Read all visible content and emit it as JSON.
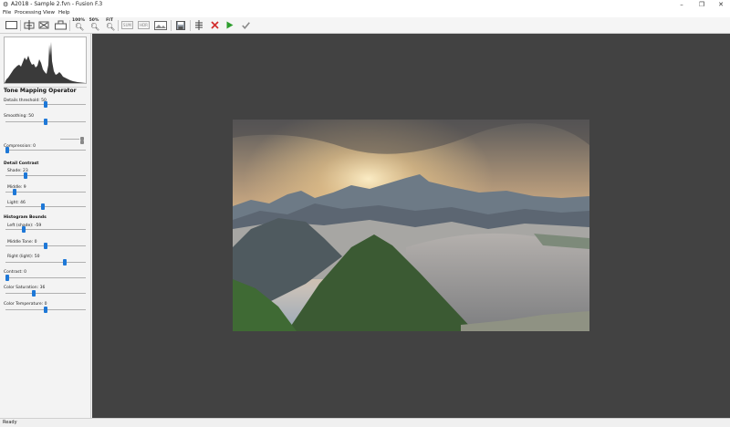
{
  "window": {
    "title": "A2018 - Sample 2.fvn - Fusion F.3",
    "app_icon": "app-logo-icon",
    "controls": [
      "minimize-icon",
      "restore-icon",
      "close-icon"
    ]
  },
  "menu": [
    "File",
    "Processing",
    "View",
    "Help"
  ],
  "toolbar": {
    "zoom_100": "100%",
    "zoom_50": "50%",
    "zoom_fit": "FIT",
    "sum_label": "SUM",
    "hdr_label": "HDR",
    "icons": [
      "frame-icon",
      "align-icon",
      "distribute-icon",
      "crop-icon",
      "zoom-icon",
      "image-icon",
      "save-icon",
      "split-icon",
      "cancel-icon",
      "run-icon",
      "apply-icon"
    ],
    "colors": {
      "cancel": "#d32f2f",
      "run": "#2e9e2e",
      "apply": "#8a8a8a"
    }
  },
  "panel": {
    "title": "Tone Mapping Operator",
    "sliders": {
      "details_threshold": {
        "label": "Details threshold: 50",
        "value": 0.5
      },
      "smoothing": {
        "label": "Smoothing: 50",
        "value": 0.5
      },
      "compression": {
        "label": "Compression: 0",
        "value": 0.0
      },
      "shade": {
        "label": "Shade: 23",
        "value": 0.24
      },
      "middle": {
        "label": "Middle: 9",
        "value": 0.1
      },
      "light": {
        "label": "Light: 46",
        "value": 0.46
      },
      "left_shade": {
        "label": "Left (shade): -59",
        "value": 0.21
      },
      "middle_tone": {
        "label": "Middle Tone: 0",
        "value": 0.5
      },
      "right_light": {
        "label": "Right (light): 50",
        "value": 0.75
      },
      "contrast": {
        "label": "Contrast: 0",
        "value": 0.0
      },
      "color_saturation": {
        "label": "Color Saturation: 36",
        "value": 0.34
      },
      "color_temperature": {
        "label": "Color Temperature: 0",
        "value": 0.5
      }
    },
    "detail_contrast_title": "Detail Contrast",
    "histogram_bounds_title": "Histogram Bounds",
    "accent": "#1e78d7"
  },
  "status": "Ready"
}
